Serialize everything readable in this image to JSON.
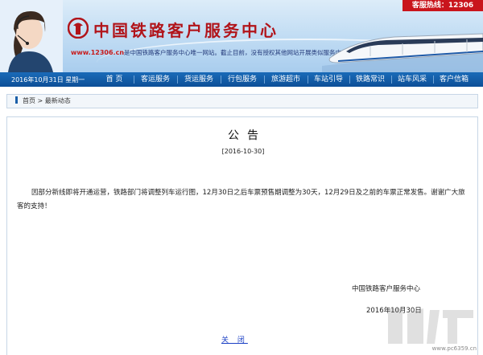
{
  "header": {
    "site_title": "中国铁路客户服务中心",
    "notice_url": "www.12306.cn",
    "notice_text": "是中国铁路客户服务中心唯一网站。截止目前，没有授权其他网站开展类似服务内容，敬请广大",
    "hotline": "客服热线：12306"
  },
  "nav": {
    "date": "2016年10月31日 星期一",
    "items": [
      "首 页",
      "客运服务",
      "货运服务",
      "行包服务",
      "旅游超市",
      "车站引导",
      "铁路常识",
      "站车风采",
      "客户信箱"
    ]
  },
  "breadcrumb": {
    "home": "首页",
    "separator": ">",
    "current": "最新动态"
  },
  "article": {
    "title": "公告",
    "date": "[2016-10-30]",
    "body": "因部分新线即将开通运营，铁路部门将调整列车运行图，12月30日之后车票预售期调整为30天，12月29日及之前的车票正常发售。谢谢广大旅客的支持！",
    "signature": "中国铁路客户服务中心",
    "sign_date": "2016年10月30日",
    "close_label": "关 闭"
  },
  "watermark": {
    "text": "www.pc6359.cn"
  },
  "colors": {
    "brand_red": "#c9151c",
    "nav_blue": "#0d4f97",
    "link_blue": "#1a3fc4"
  }
}
